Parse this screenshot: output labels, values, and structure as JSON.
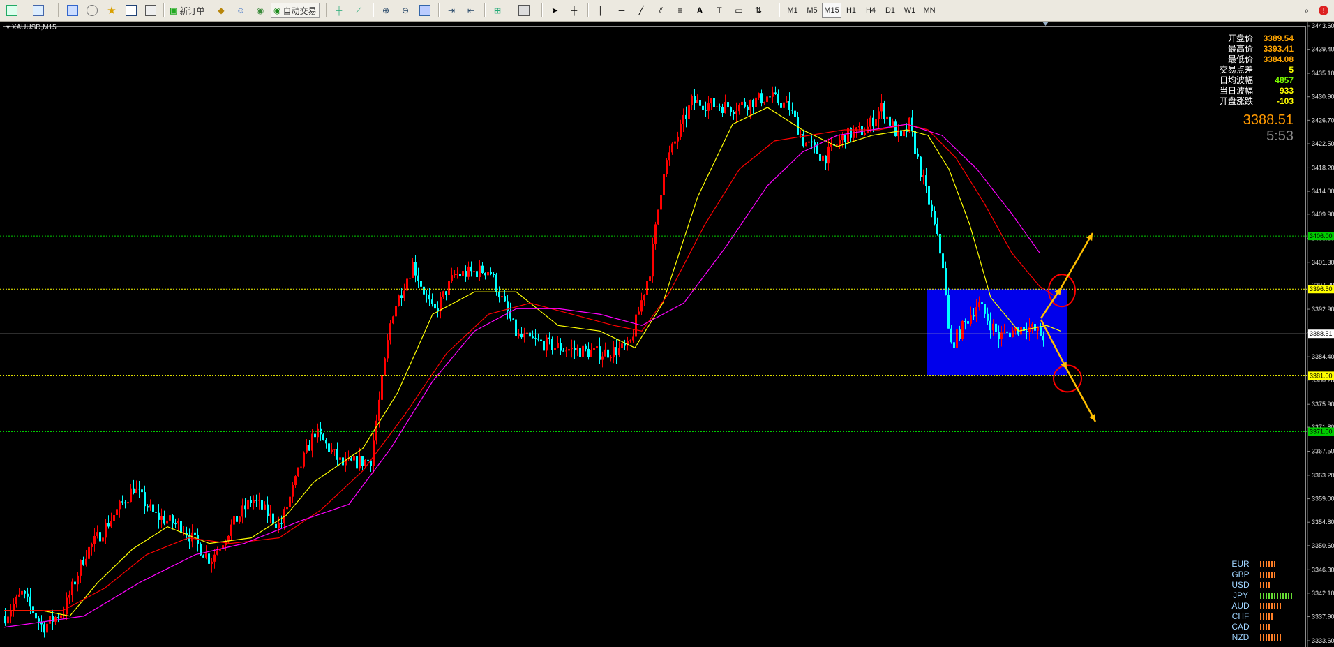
{
  "toolbar": {
    "order_button_label": "新订单",
    "autotrade_button_label": "自动交易",
    "timeframes": [
      "M1",
      "M5",
      "M15",
      "H1",
      "H4",
      "D1",
      "W1",
      "MN"
    ],
    "active_timeframe": "M15"
  },
  "chart": {
    "symbol_label": "XAUUSD,M15",
    "colors": {
      "bull": "#ff0000",
      "bear": "#00ffff",
      "ma_fast": "#ffff00",
      "ma_mid": "#ff0000",
      "ma_slow": "#ff00ff",
      "zone": "#0000ff",
      "level": "#00cc00",
      "arrow": "#ffbf00",
      "circle": "#ff0000"
    }
  },
  "price_axis": {
    "ticks": [
      "3443.60",
      "3439.40",
      "3435.10",
      "3430.90",
      "3426.70",
      "3422.50",
      "3418.20",
      "3414.00",
      "3409.90",
      "3405.60",
      "3401.30",
      "3397.20",
      "3392.90",
      "3388.70",
      "3384.40",
      "3380.20",
      "3375.90",
      "3371.80",
      "3367.50",
      "3363.20",
      "3359.00",
      "3354.80",
      "3350.60",
      "3346.30",
      "3342.10",
      "3337.90",
      "3333.60"
    ],
    "level_tags": {
      "level_1": "3406.00",
      "level_2": "3396.50",
      "current": "3388.51",
      "level_3": "3381.00",
      "level_4": "3371.00"
    }
  },
  "info_panel": {
    "rows": [
      {
        "label": "开盘价",
        "value": "3389.54"
      },
      {
        "label": "最高价",
        "value": "3393.41"
      },
      {
        "label": "最低价",
        "value": "3384.08"
      },
      {
        "label": "交易点差",
        "value": "5"
      },
      {
        "label": "日均波幅",
        "value": "4857"
      },
      {
        "label": "当日波幅",
        "value": "933"
      },
      {
        "label": "开盘涨跌",
        "value": "-103"
      }
    ],
    "label_colors": [
      "#ffa500",
      "#ffa500",
      "#ffa500",
      "#ffff00",
      "#7cfc00",
      "#ffff00",
      "#ffff00"
    ],
    "current_price": "3388.51",
    "countdown": "5:53"
  },
  "currency_strength": [
    {
      "name": "EUR",
      "level": 6,
      "color": "#ff7f27"
    },
    {
      "name": "GBP",
      "level": 6,
      "color": "#ff7f27"
    },
    {
      "name": "USD",
      "level": 4,
      "color": "#ff7f27"
    },
    {
      "name": "JPY",
      "level": 12,
      "color": "#66dd33"
    },
    {
      "name": "AUD",
      "level": 8,
      "color": "#ff7f27"
    },
    {
      "name": "CHF",
      "level": 5,
      "color": "#ff7f27"
    },
    {
      "name": "CAD",
      "level": 4,
      "color": "#ff7f27"
    },
    {
      "name": "NZD",
      "level": 8,
      "color": "#ff7f27"
    }
  ]
}
